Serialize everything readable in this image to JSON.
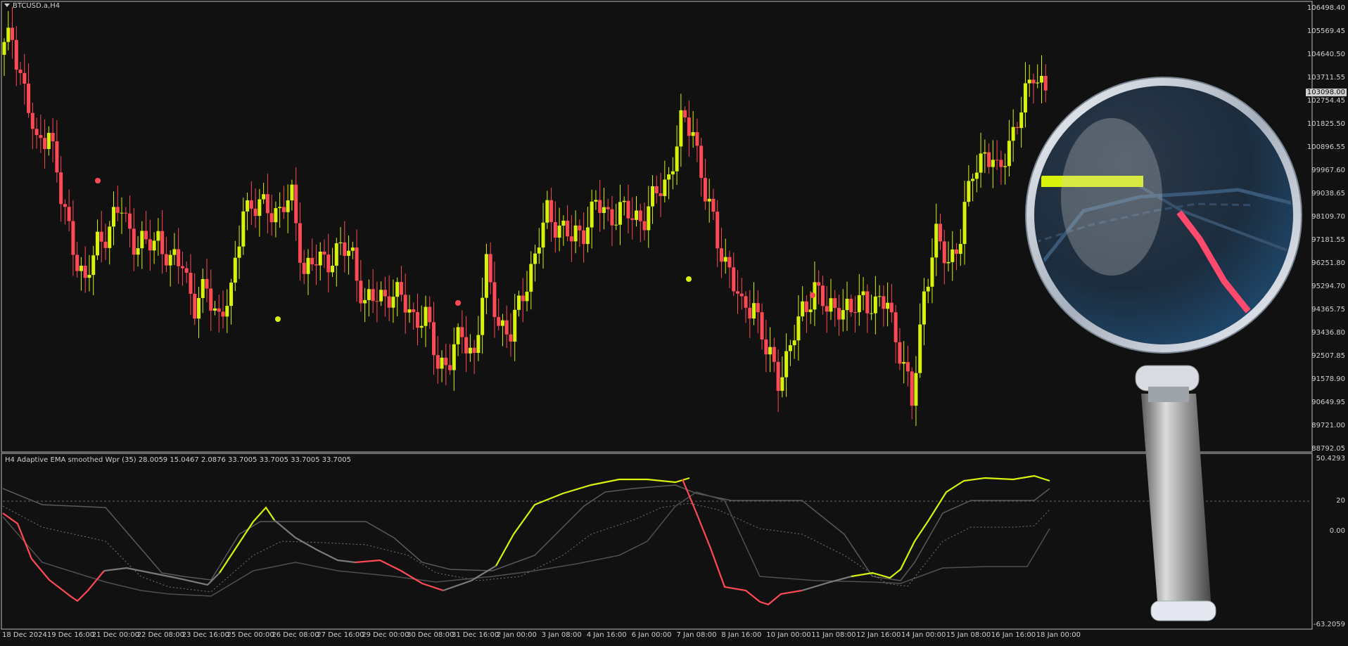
{
  "chart_title": "BTCUSD.a,H4",
  "indicator_title": "H4 Adaptive EMA smoothed Wpr (35) 28.0059 15.0467 2.0876 33.7005 33.7005 33.7005 33.7005",
  "current_price": "103098.00",
  "colors": {
    "bull": "#d7f20b",
    "bear": "#ff4a55",
    "background": "#111111",
    "grid": "#c8c8c8"
  },
  "price_axis": [
    "106498.40",
    "105569.45",
    "104640.50",
    "103711.55",
    "102754.45",
    "101825.50",
    "100896.55",
    "99967.60",
    "99038.65",
    "98109.70",
    "97181.55",
    "96251.80",
    "95294.70",
    "94365.75",
    "93436.80",
    "92507.85",
    "91578.90",
    "90649.95",
    "89721.00",
    "88792.05"
  ],
  "indicator_axis": [
    "50.4293",
    "20",
    "0.00",
    "-63.2059"
  ],
  "time_axis": [
    "18 Dec 2024",
    "19 Dec 16:00",
    "21 Dec 00:00",
    "22 Dec 08:00",
    "23 Dec 16:00",
    "25 Dec 00:00",
    "26 Dec 08:00",
    "27 Dec 16:00",
    "29 Dec 00:00",
    "30 Dec 08:00",
    "31 Dec 16:00",
    "2 Jan 00:00",
    "3 Jan 08:00",
    "4 Jan 16:00",
    "6 Jan 00:00",
    "7 Jan 08:00",
    "8 Jan 16:00",
    "10 Jan 00:00",
    "11 Jan 08:00",
    "12 Jan 16:00",
    "14 Jan 00:00",
    "15 Jan 08:00",
    "16 Jan 16:00",
    "18 Jan 00:00"
  ],
  "magnifier_icon": "magnifying-glass-icon",
  "chart_data": {
    "type": "candlestick",
    "title": "BTCUSD.a,H4",
    "ylim": [
      88792.05,
      106498.4
    ],
    "close_path": [
      104640,
      105400,
      103200,
      100900,
      101800,
      98800,
      97100,
      95300,
      97200,
      97700,
      98500,
      97200,
      96900,
      97400,
      96200,
      96400,
      94500,
      95200,
      94200,
      94900,
      98700,
      98400,
      98600,
      98300,
      98900,
      96000,
      96300,
      96500,
      96800,
      96600,
      94600,
      94900,
      95100,
      94800,
      94200,
      94000,
      92300,
      92400,
      93400,
      92600,
      96000,
      94000,
      93300,
      95200,
      96500,
      98300,
      97800,
      97200,
      97700,
      98600,
      98200,
      98400,
      98100,
      98200,
      99000,
      99800,
      101800,
      101700,
      99100,
      97100,
      96100,
      94300,
      94800,
      92700,
      91700,
      92900,
      94300,
      95400,
      94300,
      94700,
      94200,
      95000,
      94500,
      94700,
      92800,
      90600,
      95200,
      97200,
      96400,
      97300,
      100000,
      100800,
      99800,
      101200,
      102300,
      104100,
      103200
    ]
  },
  "indicator": {
    "type": "line",
    "ylim": [
      -63.2059,
      50.4293
    ],
    "levels": [
      20,
      0
    ]
  }
}
